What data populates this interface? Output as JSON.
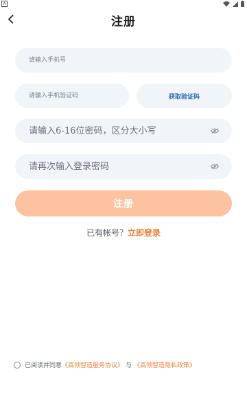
{
  "status_bar": {
    "left_icon": "A",
    "icons": [
      "wifi-icon",
      "signal-icon",
      "battery-icon"
    ]
  },
  "header": {
    "back_icon": "chevron-left-icon",
    "title": "注册"
  },
  "form": {
    "phone_placeholder": "请输入手机号",
    "code_placeholder": "请输入手机验证码",
    "get_code_label": "获取验证码",
    "password_placeholder": "请输入6-16位密码，区分大小写",
    "confirm_placeholder": "请再次输入登录密码",
    "eye_icon": "eye-icon",
    "submit_label": "注册"
  },
  "login": {
    "prompt": "已有帐号？",
    "link": "立即登录"
  },
  "agreement": {
    "prefix": "已阅读并同意",
    "service_link": "《高领智造服务协议》",
    "connector": "与",
    "privacy_link": "《高领智造隐私政策》"
  },
  "colors": {
    "accent": "#e9813a",
    "button_bg": "#fdc2a0",
    "field_bg": "#f1f5fa",
    "code_text": "#2f6db3"
  }
}
